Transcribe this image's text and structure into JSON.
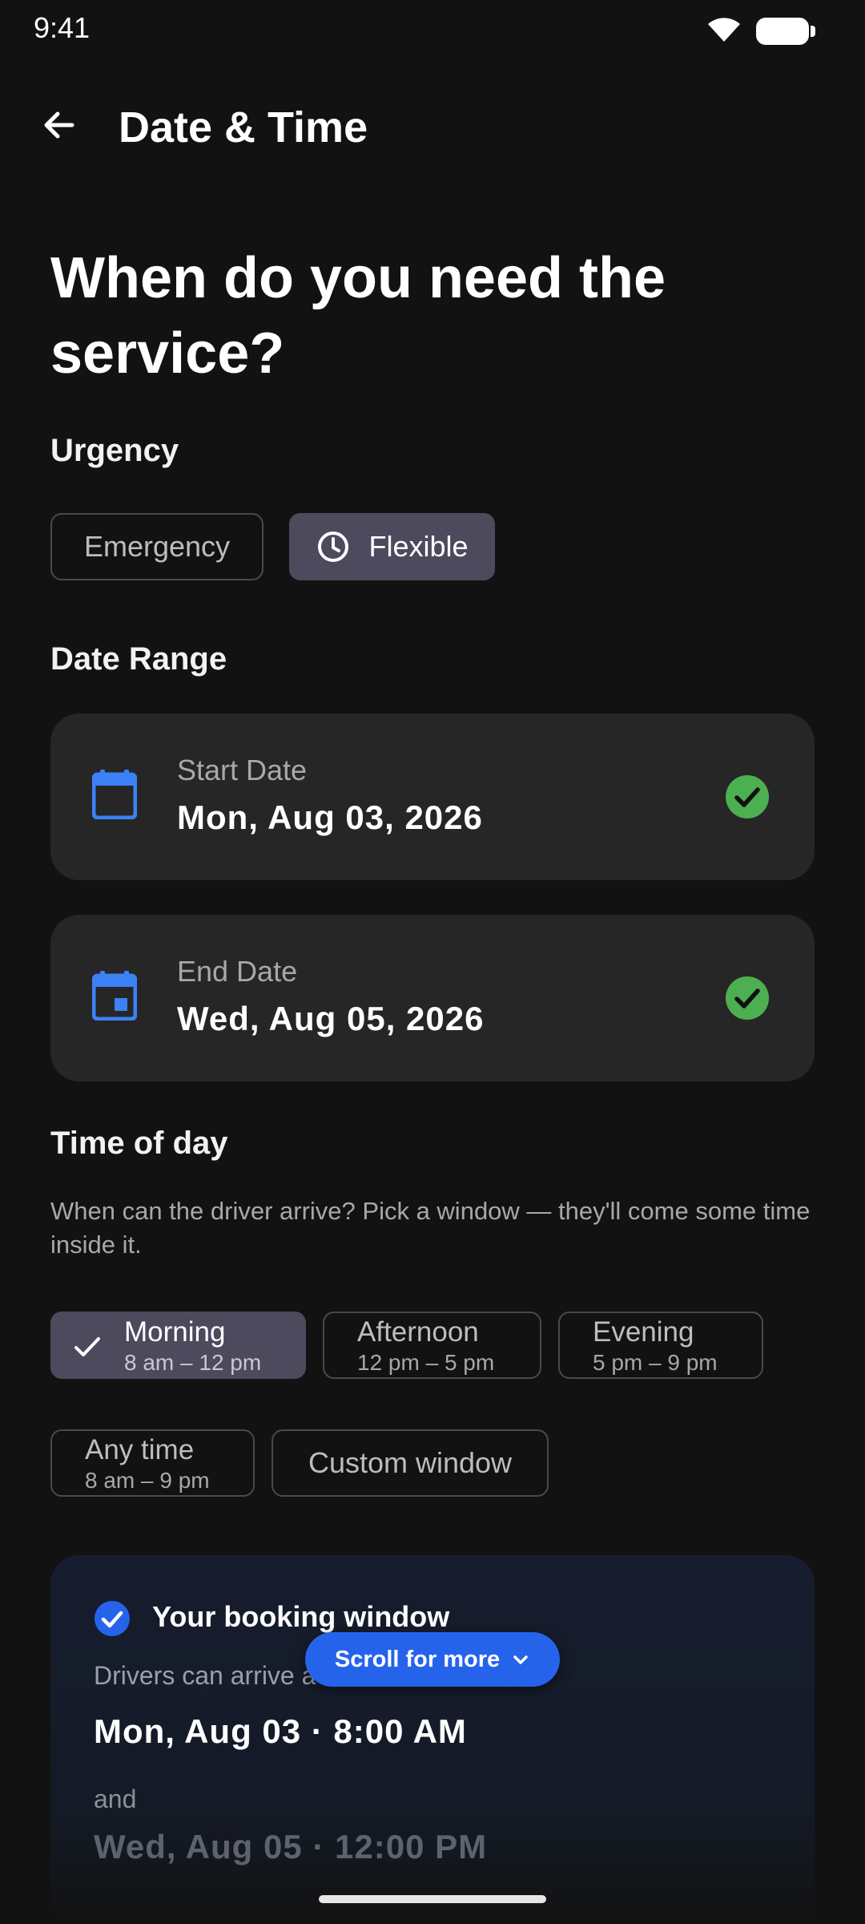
{
  "status_bar": {
    "time": "9:41"
  },
  "app_bar": {
    "title": "Date & Time"
  },
  "heading": "When do you need the service?",
  "urgency": {
    "label": "Urgency",
    "options": [
      {
        "label": "Emergency",
        "selected": false
      },
      {
        "label": "Flexible",
        "selected": true
      }
    ]
  },
  "date_range": {
    "label": "Date Range",
    "start": {
      "label": "Start Date",
      "value": "Mon, Aug 03, 2026"
    },
    "end": {
      "label": "End Date",
      "value": "Wed, Aug 05, 2026"
    }
  },
  "time_of_day": {
    "label": "Time of day",
    "description": "When can the driver arrive? Pick a window — they'll come some time inside it.",
    "options": [
      {
        "label": "Morning",
        "range": "8 am – 12 pm",
        "selected": true
      },
      {
        "label": "Afternoon",
        "range": "12 pm – 5 pm",
        "selected": false
      },
      {
        "label": "Evening",
        "range": "5 pm – 9 pm",
        "selected": false
      },
      {
        "label": "Any time",
        "range": "8 am – 9 pm",
        "selected": false
      },
      {
        "label": "Custom window",
        "selected": false
      }
    ]
  },
  "booking_window": {
    "title": "Your booking window",
    "subtitle": "Drivers can arrive a",
    "start": "Mon, Aug 03 · 8:00 AM",
    "and": "and",
    "end": "Wed, Aug 05 · 12:00 PM"
  },
  "scroll_hint": "Scroll for more",
  "colors": {
    "background": "#121212",
    "card": "#262626",
    "selected_chip": "#4d4a5e",
    "accent_blue": "#2563eb",
    "calendar_blue": "#3b82f6",
    "success_green": "#4caf50"
  }
}
